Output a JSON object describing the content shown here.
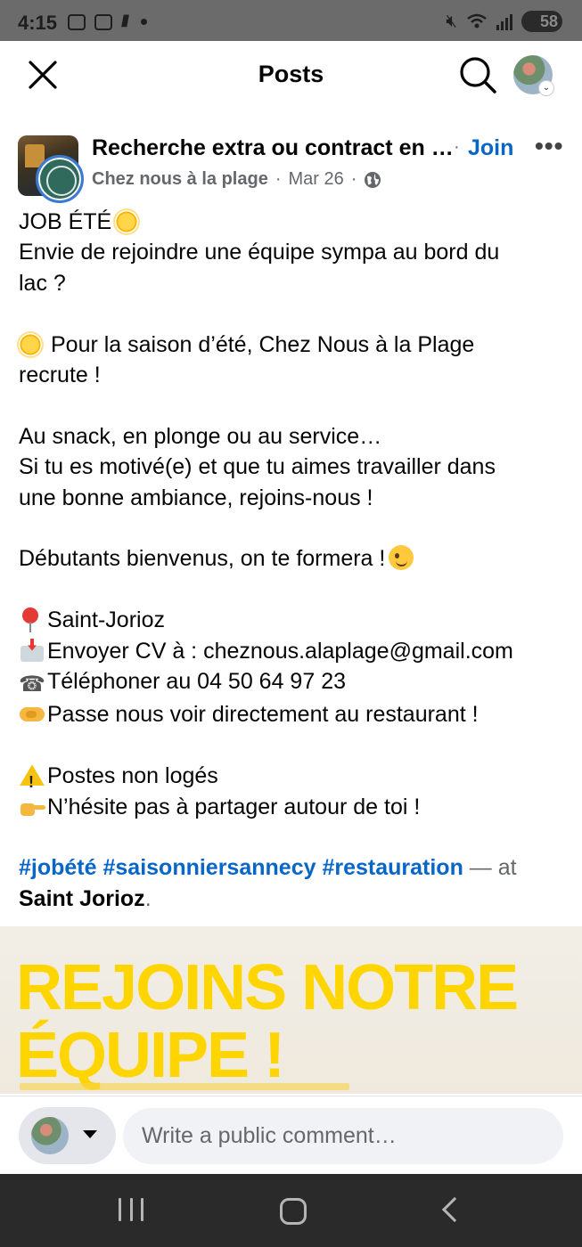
{
  "status_bar": {
    "time": "4:15",
    "battery": "58",
    "icons": [
      "screenshot-icon",
      "media-icon",
      "missed-call-icon",
      "dot-icon",
      "mute-icon",
      "wifi-icon",
      "signal-icon",
      "battery-icon"
    ]
  },
  "header": {
    "title": "Posts",
    "icons": [
      "close-icon",
      "search-icon",
      "profile-avatar"
    ]
  },
  "post": {
    "group_name": "Recherche extra ou contract en …",
    "dot": "·",
    "join_label": "Join",
    "more_label": "•••",
    "author": "Chez nous à la plage",
    "date": "Mar 26",
    "separator": "·",
    "visibility_icon": "globe-icon",
    "lines": {
      "l1": "JOB ÉTÉ",
      "l2": "Envie de rejoindre une équipe sympa au bord du",
      "l3": "lac ?",
      "l4": "Pour la saison d’été, Chez Nous à la Plage",
      "l5": "recrute !",
      "l6": "Au snack, en plonge ou au service…",
      "l7": "Si tu es motivé(e) et que tu aimes travailler dans",
      "l8": "une bonne ambiance, rejoins-nous !",
      "l9": "Débutants bienvenus, on te formera !",
      "l10": "Saint-Jorioz",
      "l11": "Envoyer CV à : cheznous.alaplage@gmail.com",
      "l12": "Téléphoner au 04 50 64 97 23",
      "l13": "Passe nous voir directement au restaurant !",
      "l14": "Postes non logés",
      "l15": "N’hésite pas à partager autour de toi !"
    },
    "hashtags": [
      "#jobété",
      "#saisonniersannecy",
      "#restauration"
    ],
    "at_text": "— at",
    "place": "Saint Jorioz",
    "place_suffix": ".",
    "image": {
      "line1": "REJOINS NOTRE",
      "line2": "ÉQUIPE !",
      "color": "#ffd500"
    }
  },
  "comment_bar": {
    "placeholder": "Write a public comment…"
  },
  "colors": {
    "link": "#0866c6",
    "meta": "#65676b",
    "nav_bar": "#2a2a2a",
    "status_bar": "#6b6b6b"
  }
}
